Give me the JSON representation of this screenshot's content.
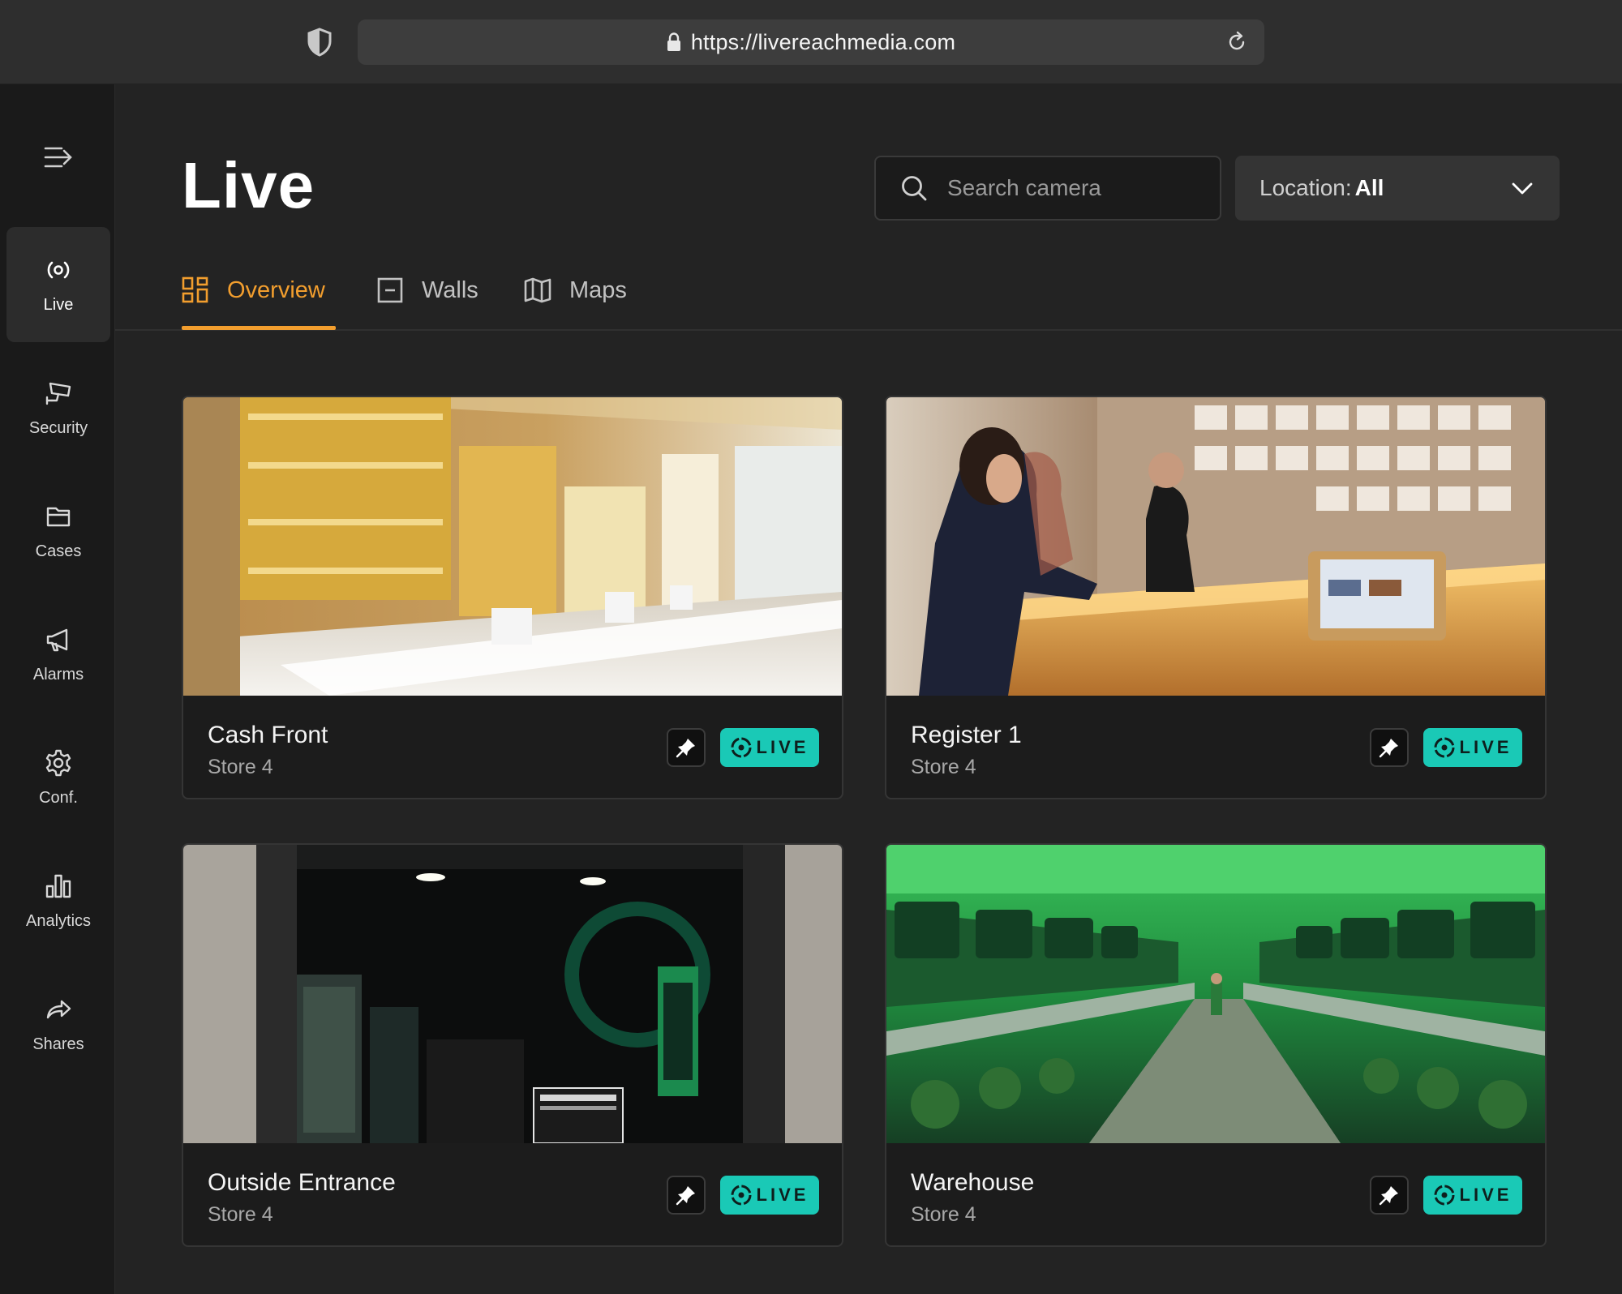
{
  "browser": {
    "url": "https://livereachmedia.com"
  },
  "sidebar": {
    "items": [
      {
        "label": "Live",
        "icon": "live-broadcast-icon",
        "active": true
      },
      {
        "label": "Security",
        "icon": "security-camera-icon"
      },
      {
        "label": "Cases",
        "icon": "folder-icon"
      },
      {
        "label": "Alarms",
        "icon": "megaphone-icon"
      },
      {
        "label": "Conf.",
        "icon": "gear-icon"
      },
      {
        "label": "Analytics",
        "icon": "bar-chart-icon"
      },
      {
        "label": "Shares",
        "icon": "share-arrow-icon"
      }
    ]
  },
  "header": {
    "title": "Live",
    "search_placeholder": "Search camera",
    "location_prefix": "Location:",
    "location_value": "All"
  },
  "tabs": [
    {
      "label": "Overview",
      "icon": "grid-icon",
      "active": true
    },
    {
      "label": "Walls",
      "icon": "wall-icon"
    },
    {
      "label": "Maps",
      "icon": "map-icon"
    }
  ],
  "cameras": [
    {
      "name": "Cash Front",
      "location": "Store 4",
      "status": "LIVE"
    },
    {
      "name": "Register 1",
      "location": "Store 4",
      "status": "LIVE"
    },
    {
      "name": "Outside Entrance",
      "location": "Store 4",
      "status": "LIVE"
    },
    {
      "name": "Warehouse",
      "location": "Store 4",
      "status": "LIVE"
    }
  ],
  "colors": {
    "accent": "#f29e2e",
    "live_badge": "#1ac9b6",
    "background": "#232323",
    "sidebar": "#1a1a1a"
  }
}
